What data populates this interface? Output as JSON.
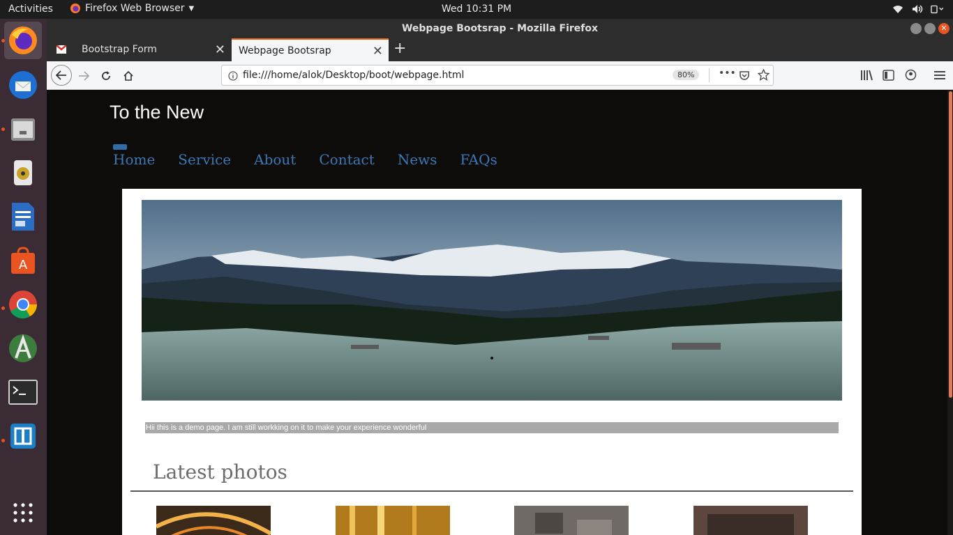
{
  "topbar": {
    "activities": "Activities",
    "app_name": "Firefox Web Browser",
    "clock": "Wed 10:31 PM",
    "tray_icons": [
      "wifi-icon",
      "volume-icon",
      "system-menu-icon"
    ]
  },
  "dock": {
    "items": [
      "firefox",
      "thunderbird",
      "files",
      "rhythmbox",
      "libreoffice-writer",
      "ubuntu-software",
      "chrome",
      "android-studio",
      "terminal",
      "virtualbox",
      "show-applications"
    ]
  },
  "window": {
    "title": "Webpage Bootsrap - Mozilla Firefox"
  },
  "tabs": [
    {
      "label": "Bootstrap Form",
      "selected": false
    },
    {
      "label": "Webpage Bootsrap",
      "selected": true
    }
  ],
  "toolbar": {
    "url": "file:///home/alok/Desktop/boot/webpage.html",
    "zoom": "80%"
  },
  "page": {
    "brand": "To the New",
    "nav": [
      "Home",
      "Service",
      "About",
      "Contact",
      "News",
      "FAQs"
    ],
    "notice": "Hii this is a demo page. I am still workking on it to make your experience wonderful",
    "section_title": "Latest photos"
  },
  "colors": {
    "page_bg": "#0e0c0b",
    "nav_link": "#3a79b6",
    "accent": "#e9661b",
    "dock_bg": "#3a2b35"
  }
}
